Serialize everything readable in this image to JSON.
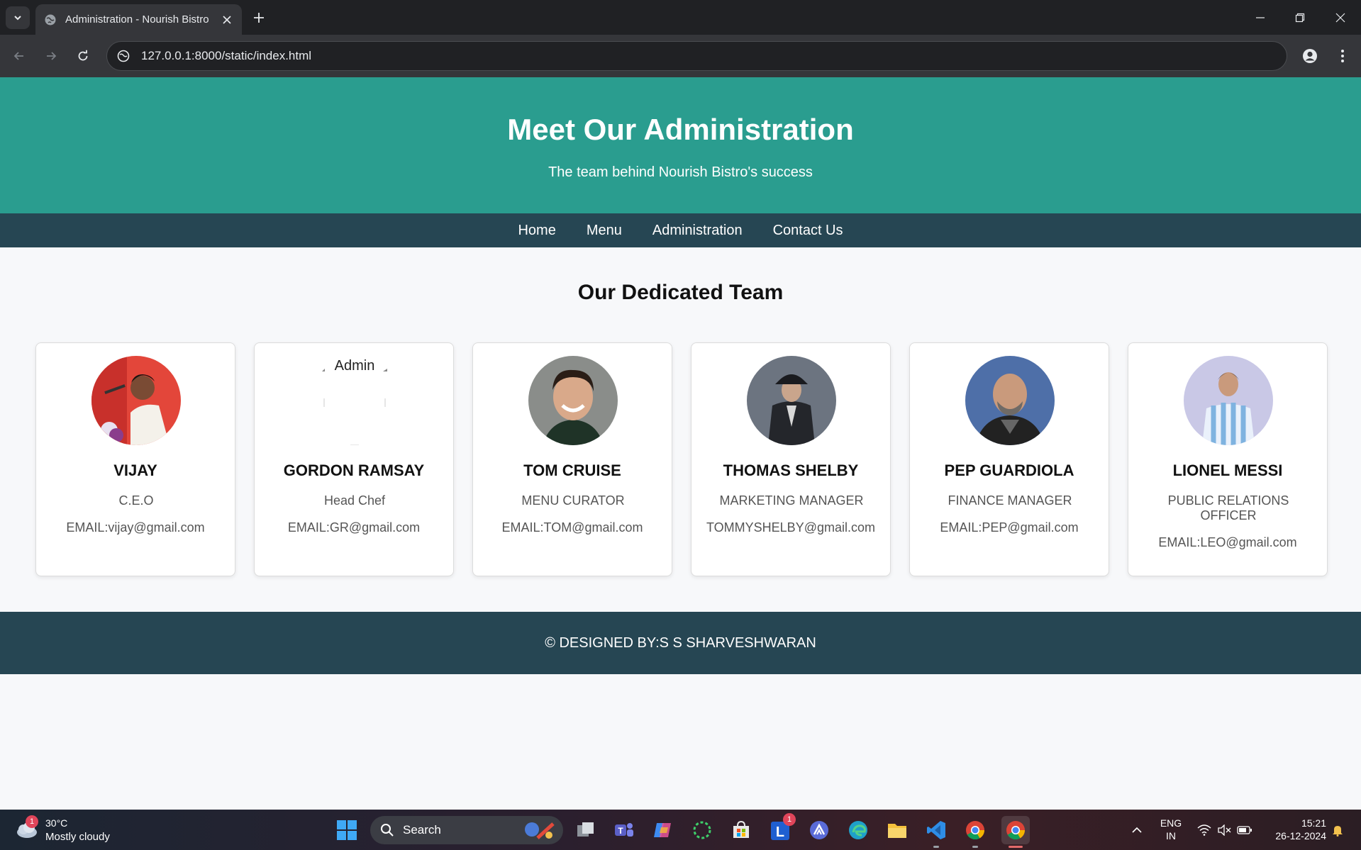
{
  "browser": {
    "tab_title": "Administration - Nourish Bistro",
    "url": "127.0.0.1:8000/static/index.html"
  },
  "header": {
    "title": "Meet Our Administration",
    "subtitle": "The team behind Nourish Bistro's success"
  },
  "nav": {
    "items": [
      "Home",
      "Menu",
      "Administration",
      "Contact Us"
    ]
  },
  "team": {
    "title": "Our Dedicated Team",
    "members": [
      {
        "name": "VIJAY",
        "role": "C.E.O",
        "email": "EMAIL:vijay@gmail.com"
      },
      {
        "name": "GORDON RAMSAY",
        "role": "Head Chef",
        "email": "EMAIL:GR@gmail.com",
        "image_alt": "Admin"
      },
      {
        "name": "TOM CRUISE",
        "role": "MENU CURATOR",
        "email": "EMAIL:TOM@gmail.com"
      },
      {
        "name": "THOMAS SHELBY",
        "role": "MARKETING MANAGER",
        "email": "TOMMYSHELBY@gmail.com"
      },
      {
        "name": "PEP GUARDIOLA",
        "role": "FINANCE MANAGER",
        "email": "EMAIL:PEP@gmail.com"
      },
      {
        "name": "LIONEL MESSI",
        "role": "PUBLIC RELATIONS OFFICER",
        "email": "EMAIL:LEO@gmail.com"
      }
    ]
  },
  "footer": {
    "text": "© DESIGNED BY:S S SHARVESHWARAN"
  },
  "taskbar": {
    "weather_temp": "30°C",
    "weather_condition": "Mostly cloudy",
    "weather_badge": "1",
    "search_label": "Search",
    "app_badge": "1",
    "language_line1": "ENG",
    "language_line2": "IN",
    "time": "15:21",
    "date": "26-12-2024"
  }
}
